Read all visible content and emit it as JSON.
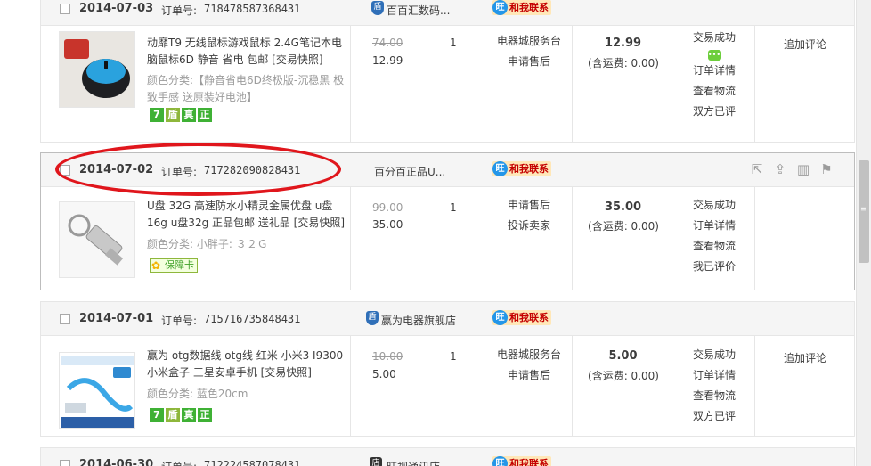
{
  "orders": [
    {
      "date": "2014-07-03",
      "order_label": "订单号:",
      "order_no": "718478587368431",
      "shop": "百百汇数码...",
      "shop_icon": "shield-badge-icon",
      "contact": "和我联系",
      "product_title": "动靡T9 无线鼠标游戏鼠标 2.4G笔记本电脑鼠标6D 静音 省电 包邮 [交易快照]",
      "props": "颜色分类:【静音省电6D终极版-沉稳黑 极致手感 送原装好电池】",
      "badges": [
        "7",
        "盾",
        "真",
        "正"
      ],
      "orig_price": "74.00",
      "unit_price": "12.99",
      "qty": "1",
      "service": [
        "电器城服务台",
        "申请售后"
      ],
      "total": "12.99",
      "shipping": "(含运费: 0.00)",
      "status": [
        "交易成功",
        "订单详情",
        "查看物流",
        "双方已评"
      ],
      "action": "追加评论"
    },
    {
      "date": "2014-07-02",
      "order_label": "订单号:",
      "order_no": "717282090828431",
      "shop": "百分百正品U...",
      "contact": "和我联系",
      "product_title": "U盘 32G 高速防水小精灵金属优盘 u盘16g u盘32g 正品包邮 送礼品 [交易快照]",
      "props": "颜色分类: 小胖子: ３２Ｇ",
      "guarantee": "保障卡",
      "orig_price": "99.00",
      "unit_price": "35.00",
      "qty": "1",
      "service": [
        "申请售后",
        "投诉卖家"
      ],
      "total": "35.00",
      "shipping": "(含运费: 0.00)",
      "status": [
        "交易成功",
        "订单详情",
        "查看物流",
        "我已评价"
      ],
      "action": ""
    },
    {
      "date": "2014-07-01",
      "order_label": "订单号:",
      "order_no": "715716735848431",
      "shop": "赢为电器旗舰店",
      "contact": "和我联系",
      "product_title": "赢为 otg数据线 otg线 红米 小米3 I9300 小米盒子 三星安卓手机 [交易快照]",
      "props": "颜色分类: 蓝色20cm",
      "badges": [
        "7",
        "盾",
        "真",
        "正"
      ],
      "orig_price": "10.00",
      "unit_price": "5.00",
      "qty": "1",
      "service": [
        "电器城服务台",
        "申请售后"
      ],
      "total": "5.00",
      "shipping": "(含运费: 0.00)",
      "status": [
        "交易成功",
        "订单详情",
        "查看物流",
        "双方已评"
      ],
      "action": "追加评论"
    }
  ],
  "partial_order": {
    "date": "2014-06-30",
    "order_label": "订单号:",
    "order_no": "712224587078431",
    "shop": "旺视通讯店",
    "contact": "和我联系"
  },
  "icons": {
    "contact": "wangwang-chat-icon",
    "share": "share-icon",
    "upload": "upload-icon",
    "delete": "trash-icon",
    "flag": "flag-icon"
  },
  "colors": {
    "accent_red": "#e0161c",
    "contact_bg": "#ffe7b8",
    "badge_green": "#3fb135"
  }
}
